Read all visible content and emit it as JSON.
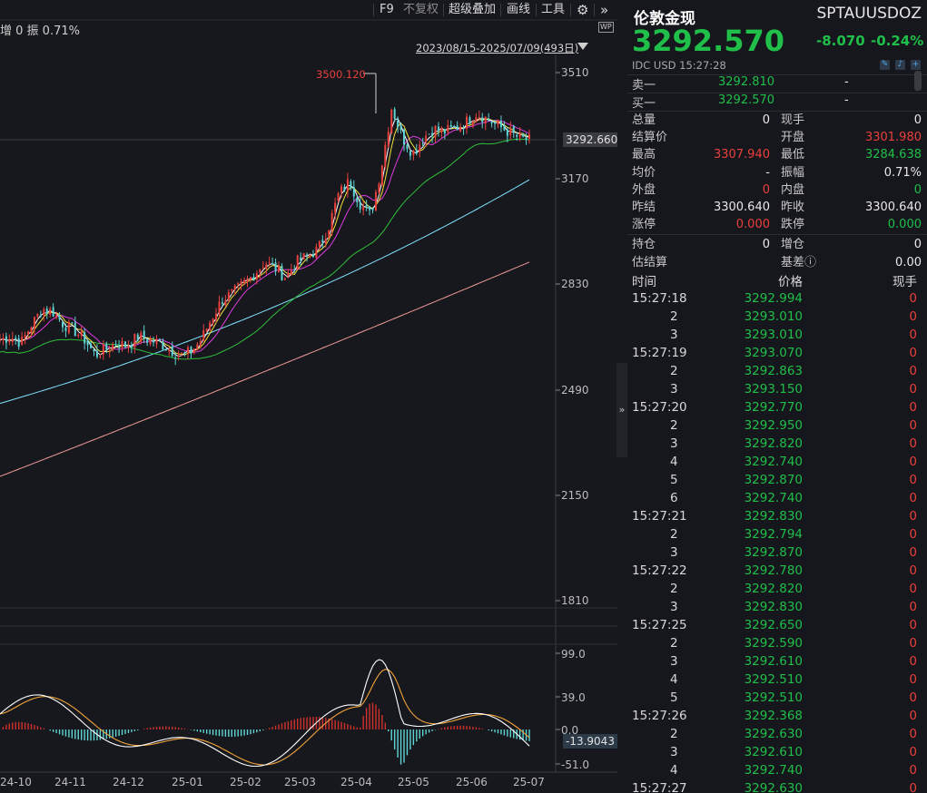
{
  "toolbar": {
    "f9": "F9",
    "fq": "不复权",
    "overlay": "超级叠加",
    "draw": "画线",
    "tools": "工具",
    "gear_icon": "gear-icon",
    "more_icon": "double-chevron-right-icon"
  },
  "chart_header": {
    "stats": "增 0   振 0.71%",
    "range": "2023/08/15-2025/07/09(493日)",
    "wp": "WP"
  },
  "price_axis": {
    "ticks": [
      "3510",
      "3170",
      "2830",
      "2490",
      "2150",
      "1810"
    ],
    "current_tag": "3292.660",
    "peak_label": "3500.120"
  },
  "indicator_axis": {
    "ticks": [
      "99.0",
      "39.0",
      "0.0",
      "-51.0"
    ],
    "current_tag": "-13.9043"
  },
  "x_axis": {
    "ticks": [
      "24-10",
      "24-11",
      "24-12",
      "25-01",
      "25-02",
      "25-03",
      "25-04",
      "25-05",
      "25-06",
      "25-07"
    ]
  },
  "colors": {
    "up": "#e8403c",
    "down": "#1fbf4a",
    "ma5": "#ffffff",
    "ma10": "#f3e23b",
    "ma20": "#e03be0",
    "ma60": "#2fbf3a",
    "ma120": "#7fe3ff",
    "ma250": "#f09a9a",
    "macd_pos": "#d0312d",
    "macd_neg": "#5fd4d4"
  },
  "chart_data": {
    "type": "candlestick",
    "series": [
      {
        "values": [
          2650,
          2660,
          2640,
          2700,
          2750,
          2740,
          2700,
          2680,
          2650,
          2600,
          2620,
          2640,
          2630,
          2660,
          2650,
          2640,
          2620,
          2600,
          2610,
          2650,
          2720,
          2780,
          2800,
          2830,
          2860,
          2900,
          2880,
          2850,
          2900,
          2920,
          2940,
          3010,
          3120,
          3160,
          3090,
          3050,
          3200,
          3400,
          3300,
          3250,
          3300,
          3330,
          3320,
          3330,
          3350,
          3380,
          3360,
          3340,
          3320,
          3300,
          3292
        ]
      }
    ]
  },
  "quote": {
    "name": "伦敦金现",
    "code": "SPTAUUSDOZ",
    "price": "3292.570",
    "change": "-8.070",
    "pct": "-0.24%",
    "meta": "IDC  USD  15:27:28",
    "sell_label": "卖一",
    "sell_price": "3292.810",
    "sell_vol": "-",
    "buy_label": "买一",
    "buy_price": "3292.570",
    "buy_vol": "-",
    "stats": [
      {
        "l1": "总量",
        "v1": "0",
        "c1": "white",
        "l2": "现手",
        "v2": "0",
        "c2": "white"
      },
      {
        "l1": "结算价",
        "v1": "",
        "c1": "white",
        "l2": "开盘",
        "v2": "3301.980",
        "c2": "red"
      },
      {
        "l1": "最高",
        "v1": "3307.940",
        "c1": "red",
        "l2": "最低",
        "v2": "3284.638",
        "c2": "green"
      },
      {
        "l1": "均价",
        "v1": "-",
        "c1": "white",
        "l2": "振幅",
        "v2": "0.71%",
        "c2": "white"
      },
      {
        "l1": "外盘",
        "v1": "0",
        "c1": "red",
        "l2": "内盘",
        "v2": "0",
        "c2": "green"
      },
      {
        "l1": "昨结",
        "v1": "3300.640",
        "c1": "white",
        "l2": "昨收",
        "v2": "3300.640",
        "c2": "white"
      },
      {
        "l1": "涨停",
        "v1": "0.000",
        "c1": "red",
        "l2": "跌停",
        "v2": "0.000",
        "c2": "green"
      },
      {
        "l1": "持仓",
        "v1": "0",
        "c1": "white",
        "l2": "增仓",
        "v2": "0",
        "c2": "white"
      },
      {
        "l1": "估结算",
        "v1": "",
        "c1": "white",
        "l2": "基差ⓘ",
        "v2": "0.00",
        "c2": "white"
      }
    ],
    "ticks_header": {
      "time": "时间",
      "price": "价格",
      "vol": "现手"
    },
    "ticks": [
      {
        "t": "15:27:18",
        "p": "3292.994",
        "v": "0"
      },
      {
        "t": "2",
        "p": "3293.010",
        "v": "0"
      },
      {
        "t": "3",
        "p": "3293.010",
        "v": "0"
      },
      {
        "t": "15:27:19",
        "p": "3293.070",
        "v": "0"
      },
      {
        "t": "2",
        "p": "3292.863",
        "v": "0"
      },
      {
        "t": "3",
        "p": "3293.150",
        "v": "0"
      },
      {
        "t": "15:27:20",
        "p": "3292.770",
        "v": "0"
      },
      {
        "t": "2",
        "p": "3292.950",
        "v": "0"
      },
      {
        "t": "3",
        "p": "3292.820",
        "v": "0"
      },
      {
        "t": "4",
        "p": "3292.740",
        "v": "0"
      },
      {
        "t": "5",
        "p": "3292.870",
        "v": "0"
      },
      {
        "t": "6",
        "p": "3292.740",
        "v": "0"
      },
      {
        "t": "15:27:21",
        "p": "3292.830",
        "v": "0"
      },
      {
        "t": "2",
        "p": "3292.794",
        "v": "0"
      },
      {
        "t": "3",
        "p": "3292.870",
        "v": "0"
      },
      {
        "t": "15:27:22",
        "p": "3292.780",
        "v": "0"
      },
      {
        "t": "2",
        "p": "3292.820",
        "v": "0"
      },
      {
        "t": "3",
        "p": "3292.830",
        "v": "0"
      },
      {
        "t": "15:27:25",
        "p": "3292.650",
        "v": "0"
      },
      {
        "t": "2",
        "p": "3292.590",
        "v": "0"
      },
      {
        "t": "3",
        "p": "3292.610",
        "v": "0"
      },
      {
        "t": "4",
        "p": "3292.510",
        "v": "0"
      },
      {
        "t": "5",
        "p": "3292.510",
        "v": "0"
      },
      {
        "t": "15:27:26",
        "p": "3292.368",
        "v": "0"
      },
      {
        "t": "2",
        "p": "3292.630",
        "v": "0"
      },
      {
        "t": "3",
        "p": "3292.610",
        "v": "0"
      },
      {
        "t": "4",
        "p": "3292.740",
        "v": "0"
      },
      {
        "t": "15:27:27",
        "p": "3292.630",
        "v": "0"
      }
    ]
  }
}
